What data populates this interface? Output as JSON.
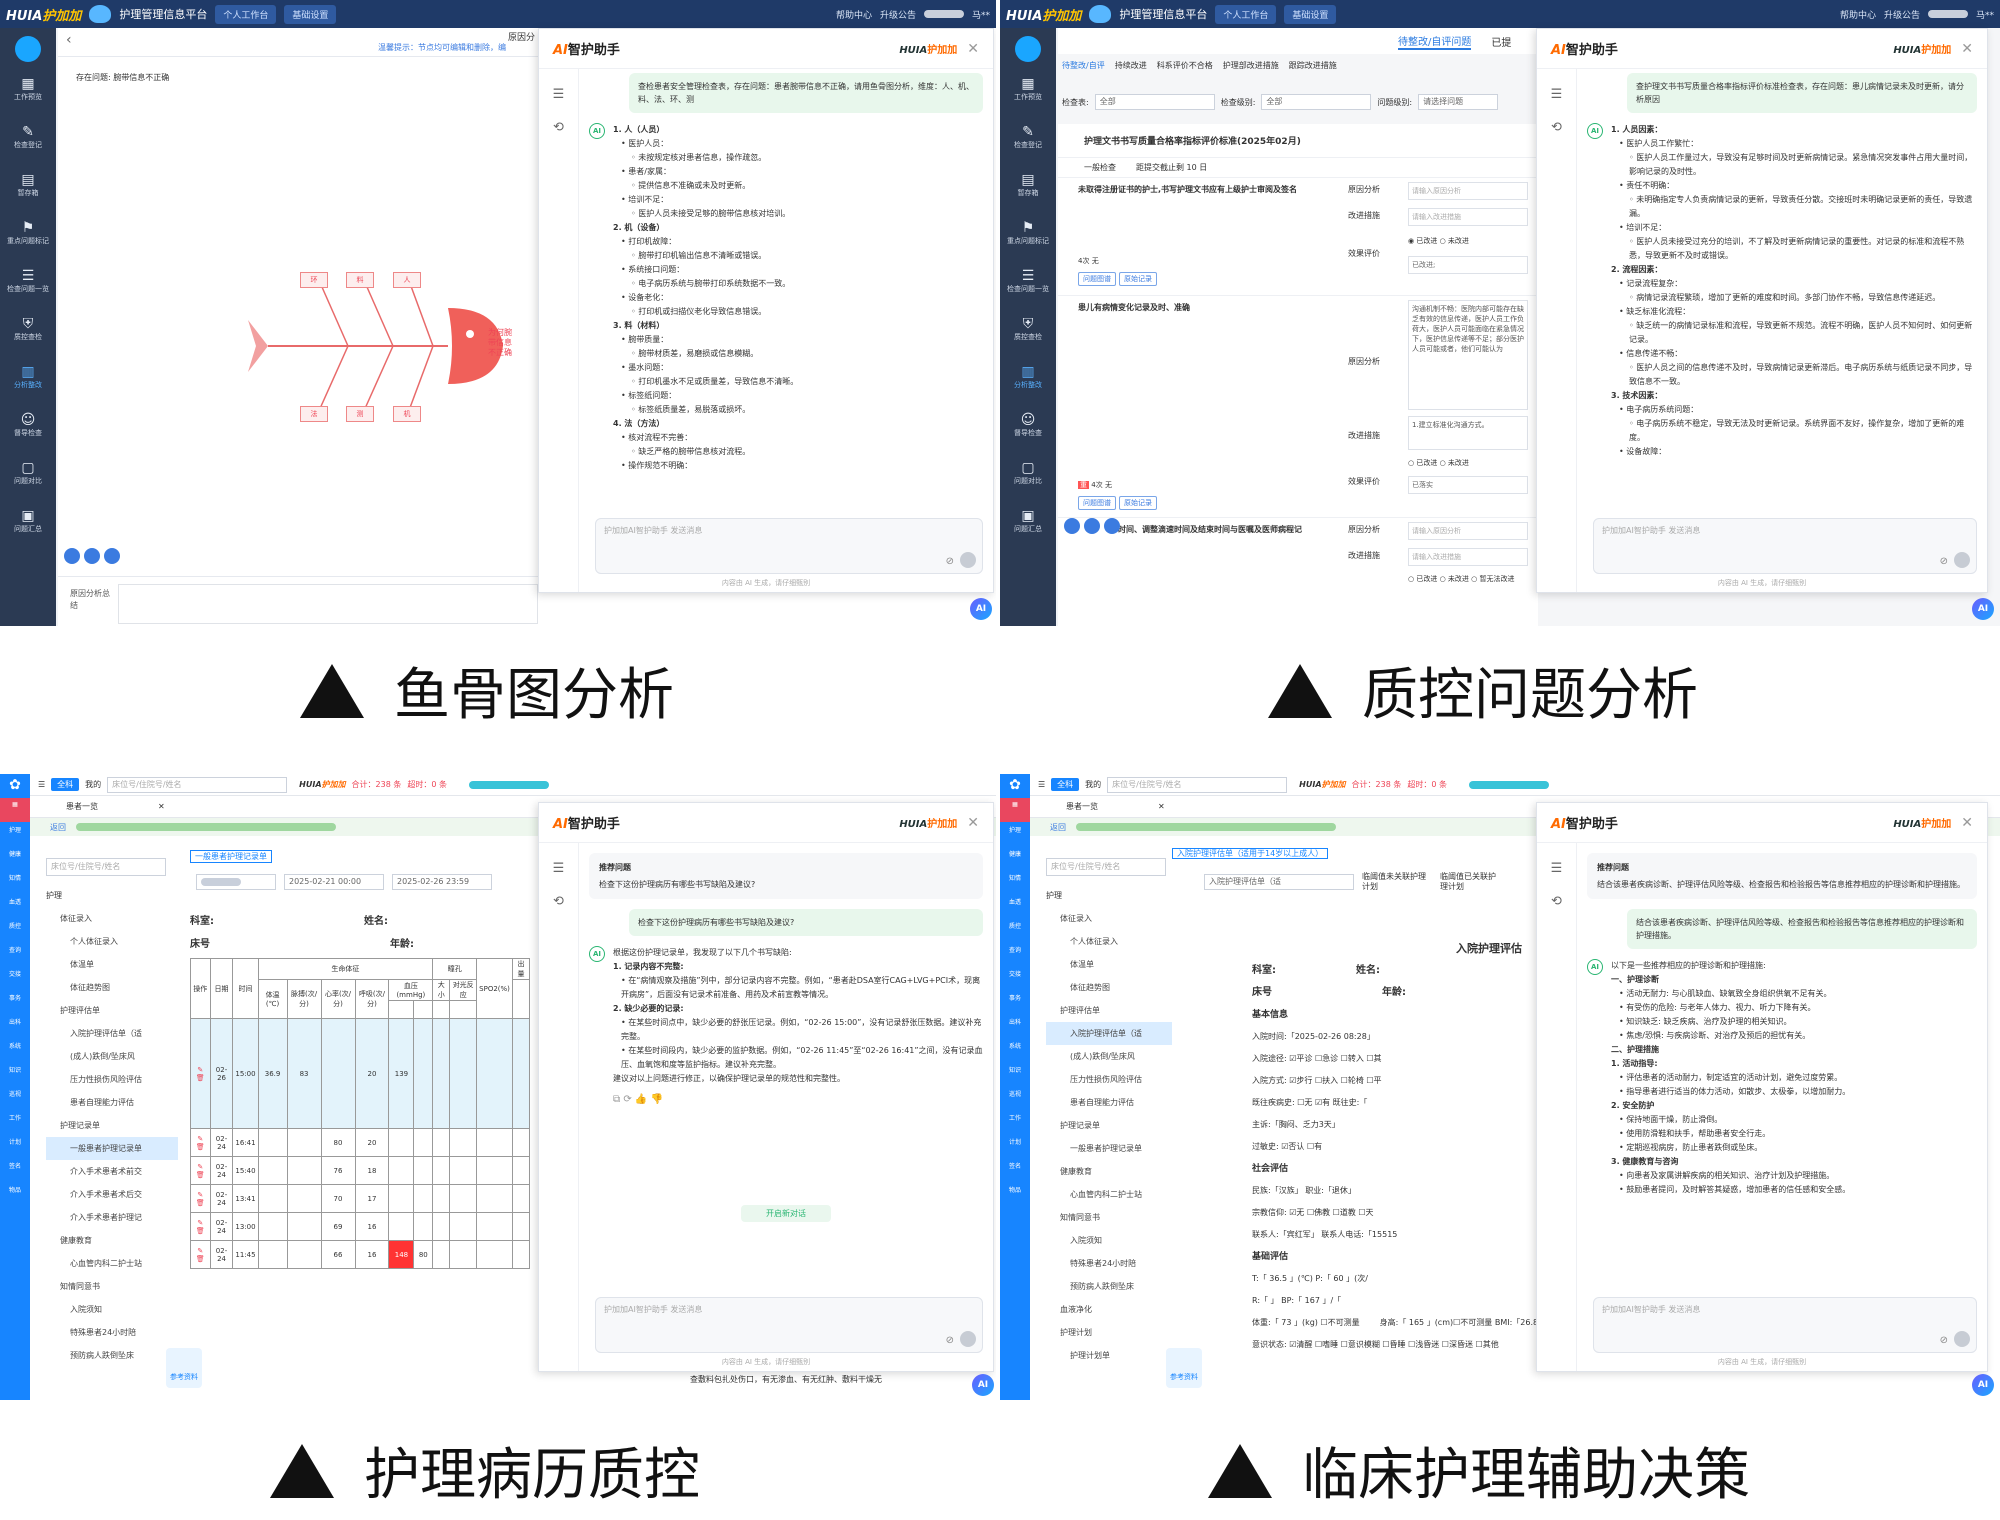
{
  "common": {
    "brand_a": "HUIA",
    "brand_b": "护加加",
    "platform": "护理管理信息平台",
    "nav_workbench": "个人工作台",
    "nav_settings": "基础设置",
    "help": "帮助中心",
    "upgrade": "升级公告",
    "upgrade_count": "229",
    "user": "马**",
    "ai_title_prefix": "AI",
    "ai_title": "智护助手",
    "ai_brand_a": "HUIA",
    "ai_brand_b": "护加加",
    "input_placeholder": "护加加AI智护助手 发送消息",
    "disclaimer": "内容由 AI 生成，请仔细甄别",
    "ai_badge": "AI"
  },
  "rail": [
    {
      "icon": "grid-icon",
      "label": "工作预览"
    },
    {
      "icon": "edit-icon",
      "label": "检查登记"
    },
    {
      "icon": "tray-icon",
      "label": "暂存箱"
    },
    {
      "icon": "flag-icon",
      "label": "重点问题标记"
    },
    {
      "icon": "list-icon",
      "label": "检查问题一览"
    },
    {
      "icon": "shield-icon",
      "label": "质控查检"
    },
    {
      "icon": "chart-icon",
      "label": "分析整改"
    },
    {
      "icon": "people-icon",
      "label": "督导检查"
    },
    {
      "icon": "doc-icon",
      "label": "问题对比"
    },
    {
      "icon": "file-icon",
      "label": "问题汇总"
    }
  ],
  "panel1": {
    "header_right": "原因分",
    "tip": "温馨提示：节点均可编辑和删除，编",
    "problem": "存在问题: 腕带信息不正确",
    "fish_top": [
      "环",
      "料",
      "人"
    ],
    "fish_bottom": [
      "法",
      "测",
      "机"
    ],
    "fish_head": "为何腕带信息不正确",
    "footer_label": "原因分析总结",
    "user_msg": "查检患者安全管理检查表，存在问题：患者腕带信息不正确，请用鱼骨图分析，维度：人、机、料、法、环、测",
    "answer": [
      {
        "cls": "h",
        "t": "1. 人（人员）"
      },
      {
        "cls": "l1",
        "t": "• 医护人员："
      },
      {
        "cls": "l2",
        "t": "◦ 未按规定核对患者信息，操作疏忽。"
      },
      {
        "cls": "l1",
        "t": "• 患者/家属："
      },
      {
        "cls": "l2",
        "t": "◦ 提供信息不准确或未及时更新。"
      },
      {
        "cls": "l1",
        "t": "• 培训不足："
      },
      {
        "cls": "l2",
        "t": "◦ 医护人员未接受足够的腕带信息核对培训。"
      },
      {
        "cls": "h",
        "t": "2. 机（设备）"
      },
      {
        "cls": "l1",
        "t": "• 打印机故障："
      },
      {
        "cls": "l2",
        "t": "◦ 腕带打印机输出信息不清晰或错误。"
      },
      {
        "cls": "l1",
        "t": "• 系统接口问题："
      },
      {
        "cls": "l2",
        "t": "◦ 电子病历系统与腕带打印系统数据不一致。"
      },
      {
        "cls": "l1",
        "t": "• 设备老化："
      },
      {
        "cls": "l2",
        "t": "◦ 打印机或扫描仪老化导致信息错误。"
      },
      {
        "cls": "h",
        "t": "3. 料（材料）"
      },
      {
        "cls": "l1",
        "t": "• 腕带质量："
      },
      {
        "cls": "l2",
        "t": "◦ 腕带材质差，易磨损或信息模糊。"
      },
      {
        "cls": "l1",
        "t": "• 墨水问题："
      },
      {
        "cls": "l2",
        "t": "◦ 打印机墨水不足或质量差，导致信息不清晰。"
      },
      {
        "cls": "l1",
        "t": "• 标签纸问题："
      },
      {
        "cls": "l2",
        "t": "◦ 标签纸质量差，易脱落或损坏。"
      },
      {
        "cls": "h",
        "t": "4. 法（方法）"
      },
      {
        "cls": "l1",
        "t": "• 核对流程不完善："
      },
      {
        "cls": "l2",
        "t": "◦ 缺乏严格的腕带信息核对流程。"
      },
      {
        "cls": "l1",
        "t": "• 操作规范不明确："
      }
    ]
  },
  "panel2": {
    "tabs": [
      "待整改/自评问题",
      "已提"
    ],
    "subtabs": [
      "待整改/自评",
      "持续改进",
      "科系评价不合格",
      "护理部改进措施",
      "跟踪改进措施"
    ],
    "filter_check": "检查表:",
    "filter_all": "全部",
    "filter_level": "检查级别:",
    "filter_level_val": "全部",
    "filter_prob": "问题级别:",
    "filter_prob_val": "请选择问题",
    "table_title": "护理文书书写质量合格率指标评价标准(2025年02月)",
    "section": "一般检查",
    "deadline": "距提交截止剩 10 日",
    "item1": "未取得注册证书的护士,书写护理文书应有上级护士审阅及签名",
    "item2": "患儿有病情变化记录及时、准确",
    "item3": "时间、调整滴速时间及结束时间与医嘱及医师病程记",
    "col_reason": "原因分析",
    "col_measure": "改进措施",
    "col_eval": "效果评价",
    "ph_reason": "请输入原因分析",
    "ph_measure": "请输入改进措施",
    "improved": "已改进",
    "not_improved": "未改进",
    "unable": "暂无法改进",
    "improved_status": "已改进;",
    "implemented": "已落实",
    "count_4": "4次",
    "none": "无",
    "btn_problem": "问题图谱",
    "btn_record": "原始记录",
    "reason_text": "沟通机制不畅：医院内部可能存在缺乏有效的信息传递，医护人员工作负荷大，医护人员可能面临在紧急情况下，医护信息传递等不足；部分医护人员可能或者，他们可能认为",
    "measure_text": "1.建立标准化沟通方式。",
    "user_msg": "查护理文书书写质量合格率指标评价标准检查表，存在问题：患儿病情记录未及时更新，请分析原因",
    "answer": [
      {
        "cls": "h",
        "t": "1. 人员因素："
      },
      {
        "cls": "l1",
        "t": "• 医护人员工作繁忙："
      },
      {
        "cls": "l2",
        "t": "◦ 医护人员工作量过大，导致没有足够时间及时更新病情记录。紧急情况突发事件占用大量时间，影响记录的及时性。"
      },
      {
        "cls": "l1",
        "t": "• 责任不明确："
      },
      {
        "cls": "l2",
        "t": "◦ 未明确指定专人负责病情记录的更新，导致责任分散。交接班时未明确记录更新的责任，导致遗漏。"
      },
      {
        "cls": "l1",
        "t": "• 培训不足："
      },
      {
        "cls": "l2",
        "t": "◦ 医护人员未接受过充分的培训，不了解及时更新病情记录的重要性。对记录的标准和流程不熟悉，导致更新不及时或错误。"
      },
      {
        "cls": "h",
        "t": "2. 流程因素："
      },
      {
        "cls": "l1",
        "t": "• 记录流程复杂："
      },
      {
        "cls": "l2",
        "t": "◦ 病情记录流程繁琐，增加了更新的难度和时间。多部门协作不畅，导致信息传递延迟。"
      },
      {
        "cls": "l1",
        "t": "• 缺乏标准化流程："
      },
      {
        "cls": "l2",
        "t": "◦ 缺乏统一的病情记录标准和流程，导致更新不规范。流程不明确，医护人员不知何时、如何更新记录。"
      },
      {
        "cls": "l1",
        "t": "• 信息传递不畅："
      },
      {
        "cls": "l2",
        "t": "◦ 医护人员之间的信息传递不及时，导致病情记录更新滞后。电子病历系统与纸质记录不同步，导致信息不一致。"
      },
      {
        "cls": "h",
        "t": "3. 技术因素："
      },
      {
        "cls": "l1",
        "t": "• 电子病历系统问题："
      },
      {
        "cls": "l2",
        "t": "◦ 电子病历系统不稳定，导致无法及时更新记录。系统界面不友好，操作复杂，增加了更新的难度。"
      },
      {
        "cls": "l1",
        "t": "• 设备故障："
      }
    ]
  },
  "panel3": {
    "tab_all": "全科",
    "tab_mine": "我的",
    "search_ph": "床位号/住院号/姓名",
    "total": "合计：238 条",
    "overdue": "超时：0 条",
    "breadcrumb": "患者一览",
    "back": "返回",
    "tab_record": "一般患者护理记录单",
    "date_from": "2025-02-21 00:00",
    "date_to": "2025-02-26 23:59",
    "dept": "科室:",
    "name": "姓名:",
    "bed": "床号",
    "age": "年龄:",
    "tree": [
      {
        "cls": "",
        "t": "护理"
      },
      {
        "cls": "sub",
        "t": "体征录入"
      },
      {
        "cls": "sub2",
        "t": "个人体征录入"
      },
      {
        "cls": "sub2",
        "t": "体温单"
      },
      {
        "cls": "sub2",
        "t": "体征趋势图"
      },
      {
        "cls": "sub",
        "t": "护理评估单"
      },
      {
        "cls": "sub2",
        "t": "入院护理评估单（适"
      },
      {
        "cls": "sub2",
        "t": "(成人)跌倒/坠床风"
      },
      {
        "cls": "sub2",
        "t": "压力性损伤风险评估"
      },
      {
        "cls": "sub2",
        "t": "患者自理能力评估"
      },
      {
        "cls": "sub",
        "t": "护理记录单"
      },
      {
        "cls": "sub2 hl",
        "t": "一般患者护理记录单"
      },
      {
        "cls": "sub2",
        "t": "介入手术患者术前交"
      },
      {
        "cls": "sub2",
        "t": "介入手术患者术后交"
      },
      {
        "cls": "sub2",
        "t": "介入手术患者护理记"
      },
      {
        "cls": "sub",
        "t": "健康教育"
      },
      {
        "cls": "sub2",
        "t": "心血管内科二护士站"
      },
      {
        "cls": "sub",
        "t": "知情同意书"
      },
      {
        "cls": "sub2",
        "t": "入院须知"
      },
      {
        "cls": "sub2",
        "t": "特殊患者24小时陪"
      },
      {
        "cls": "sub2",
        "t": "预防病人跌倒坠床"
      }
    ],
    "th": [
      "操作",
      "日期",
      "时间",
      "体温(℃)",
      "脉搏(次/分)",
      "心率(次/分)",
      "呼吸(次/分)",
      "血压(mmHg)",
      "大小",
      "对光反应",
      "SPO2(%)"
    ],
    "th_vital": "生命体征",
    "th_pupil": "瞳孔",
    "th_out": "出量",
    "rows": [
      {
        "d": "02-26",
        "t": "15:00",
        "temp": "36.9",
        "p": "83",
        "hr": "",
        "r": "20",
        "bp": "139"
      },
      {
        "d": "02-24",
        "t": "16:41",
        "temp": "",
        "p": "",
        "hr": "80",
        "r": "20",
        "bp": ""
      },
      {
        "d": "02-24",
        "t": "15:40",
        "temp": "",
        "p": "",
        "hr": "76",
        "r": "18",
        "bp": ""
      },
      {
        "d": "02-24",
        "t": "13:41",
        "temp": "",
        "p": "",
        "hr": "70",
        "r": "17",
        "bp": ""
      },
      {
        "d": "02-24",
        "t": "13:00",
        "temp": "",
        "p": "",
        "hr": "69",
        "r": "16",
        "bp": ""
      },
      {
        "d": "02-24",
        "t": "11:45",
        "temp": "",
        "p": "",
        "hr": "66",
        "r": "16",
        "bp": "148",
        "bp2": "80"
      }
    ],
    "ref_label": "参考资料",
    "bottom_text": "查敷料包扎处伤口，有无渗血、有无红肿、敷料干燥无",
    "rec_title": "推荐问题",
    "rec_q": "检查下这份护理病历有哪些书写缺陷及建议?",
    "user_msg": "检查下这份护理病历有哪些书写缺陷及建议?",
    "answer": [
      {
        "cls": "",
        "t": "根据这份护理记录单，我发现了以下几个书写缺陷:"
      },
      {
        "cls": "h",
        "t": "1. 记录内容不完整:"
      },
      {
        "cls": "l1",
        "t": "• 在“病情观察及措施”列中，部分记录内容不完整。例如，“患者赴DSA室行CAG+LVG+PCI术，现离开病房”，后面没有记录术前准备、用药及术前宣教等情况。"
      },
      {
        "cls": "h",
        "t": "2. 缺少必要的记录:"
      },
      {
        "cls": "l1",
        "t": "• 在某些时间点中，缺少必要的舒张压记录。例如，“02-26 15:00”，没有记录舒张压数据。建议补充完整。"
      },
      {
        "cls": "l1",
        "t": "• 在某些时间段内，缺少必要的监护数据。例如，“02-26 11:45”至“02-26 16:41”之间，没有记录血压、血氧饱和度等监护指标。建议补充完整。"
      },
      {
        "cls": "",
        "t": " "
      },
      {
        "cls": "",
        "t": "建议对以上问题进行修正，以确保护理记录单的规范性和完整性。"
      }
    ],
    "new_chat": "开启新对话"
  },
  "panel4": {
    "tab_record": "入院护理评估单（适用于14岁以上成人）",
    "sel_form": "入院护理评估单（适",
    "opt1": "临阈值未关联护理计划",
    "opt2": "临阈值已关联护理计划",
    "form_title": "入院护理评估",
    "basic": "基本信息",
    "admit_time": "入院时间:「2025-02-26 08:28」",
    "admit_way": "入院途径: ☑平诊 ☐急诊 ☐转入 ☐其",
    "admit_mode": "入院方式: ☑步行 ☐扶入 ☐轮椅 ☐平",
    "history": "既往疾病史: ☐无 ☑有 既往史:「",
    "complaint": "主诉:「胸闷、乏力3天」",
    "allergy": "过敏史: ☑否认 ☐有",
    "social": "社会评估",
    "nation": "民族:「汉族」 职业:「退休」",
    "religion": "宗教信仰: ☑无 ☐佛教 ☐道教 ☐天",
    "contact": "联系人:「宾红军」 联系人电话:「15515",
    "vital": "基础评估",
    "vt1": "T:「 36.5 」(℃)  P:「 60 」(次/",
    "vt2": "R:「  」     BP:「 167 」/「",
    "weight": "体重:「 73 」(kg) ☐不可测量",
    "height": "身高:「 165 」(cm)☐不可测量  BMI:「26.81」",
    "conscious": "意识状态: ☑清醒 ☐嗜睡 ☐意识模糊 ☐昏睡 ☐浅昏迷 ☐深昏迷 ☐其他",
    "tree": [
      {
        "cls": "",
        "t": "护理"
      },
      {
        "cls": "sub",
        "t": "体征录入"
      },
      {
        "cls": "sub2",
        "t": "个人体征录入"
      },
      {
        "cls": "sub2",
        "t": "体温单"
      },
      {
        "cls": "sub2",
        "t": "体征趋势图"
      },
      {
        "cls": "sub",
        "t": "护理评估单"
      },
      {
        "cls": "sub2 hl",
        "t": "入院护理评估单（适"
      },
      {
        "cls": "sub2",
        "t": "(成人)跌倒/坠床风"
      },
      {
        "cls": "sub2",
        "t": "压力性损伤风险评估"
      },
      {
        "cls": "sub2",
        "t": "患者自理能力评估"
      },
      {
        "cls": "sub",
        "t": "护理记录单"
      },
      {
        "cls": "sub2",
        "t": "一般患者护理记录单"
      },
      {
        "cls": "sub",
        "t": "健康教育"
      },
      {
        "cls": "sub2",
        "t": "心血管内科二护士站"
      },
      {
        "cls": "sub",
        "t": "知情同意书"
      },
      {
        "cls": "sub2",
        "t": "入院须知"
      },
      {
        "cls": "sub2",
        "t": "特殊患者24小时陪"
      },
      {
        "cls": "sub2",
        "t": "预防病人跌倒坠床"
      },
      {
        "cls": "sub",
        "t": "血液净化"
      },
      {
        "cls": "sub",
        "t": "护理计划"
      },
      {
        "cls": "sub2",
        "t": "护理计划单"
      }
    ],
    "rec_title": "推荐问题",
    "rec_q": "结合该患者疾病诊断、护理评估风险等级、检查报告和检验报告等信息推荐相应的护理诊断和护理措施。",
    "user_msg": "结合该患者疾病诊断、护理评估风险等级、检查报告和检验报告等信息推荐相应的护理诊断和护理措施。",
    "answer": [
      {
        "cls": "",
        "t": "以下是一些推荐相应的护理诊断和护理措施:"
      },
      {
        "cls": "",
        "t": " "
      },
      {
        "cls": "h",
        "t": "一、护理诊断"
      },
      {
        "cls": "l1",
        "t": "• 活动无耐力: 与心肌缺血、缺氧致全身组织供氧不足有关。"
      },
      {
        "cls": "l1",
        "t": "• 有受伤的危险: 与老年人体力、视力、听力下降有关。"
      },
      {
        "cls": "l1",
        "t": "• 知识缺乏: 缺乏疾病、治疗及护理的相关知识。"
      },
      {
        "cls": "l1",
        "t": "• 焦虑/恐惧: 与疾病诊断、对治疗及预后的担忧有关。"
      },
      {
        "cls": "",
        "t": " "
      },
      {
        "cls": "h",
        "t": "二、护理措施"
      },
      {
        "cls": "h",
        "t": "1. 活动指导:"
      },
      {
        "cls": "l1",
        "t": "• 评估患者的活动耐力，制定适宜的活动计划，避免过度劳累。"
      },
      {
        "cls": "l1",
        "t": "• 指导患者进行适当的体力活动，如散步、太极拳，以增加耐力。"
      },
      {
        "cls": "h",
        "t": "2. 安全防护"
      },
      {
        "cls": "l1",
        "t": "• 保持地面干燥，防止滑倒。"
      },
      {
        "cls": "l1",
        "t": "• 使用防滑鞋和扶手，帮助患者安全行走。"
      },
      {
        "cls": "l1",
        "t": "• 定期巡视病房，防止患者跌倒或坠床。"
      },
      {
        "cls": "h",
        "t": "3. 健康教育与咨询"
      },
      {
        "cls": "l1",
        "t": "• 向患者及家属讲解疾病的相关知识、治疗计划及护理措施。"
      },
      {
        "cls": "l1",
        "t": "• 鼓励患者提问，及时解答其疑惑，增加患者的信任感和安全感。"
      }
    ]
  },
  "captions": [
    "鱼骨图分析",
    "质控问题分析",
    "护理病历质控",
    "临床护理辅助决策"
  ]
}
